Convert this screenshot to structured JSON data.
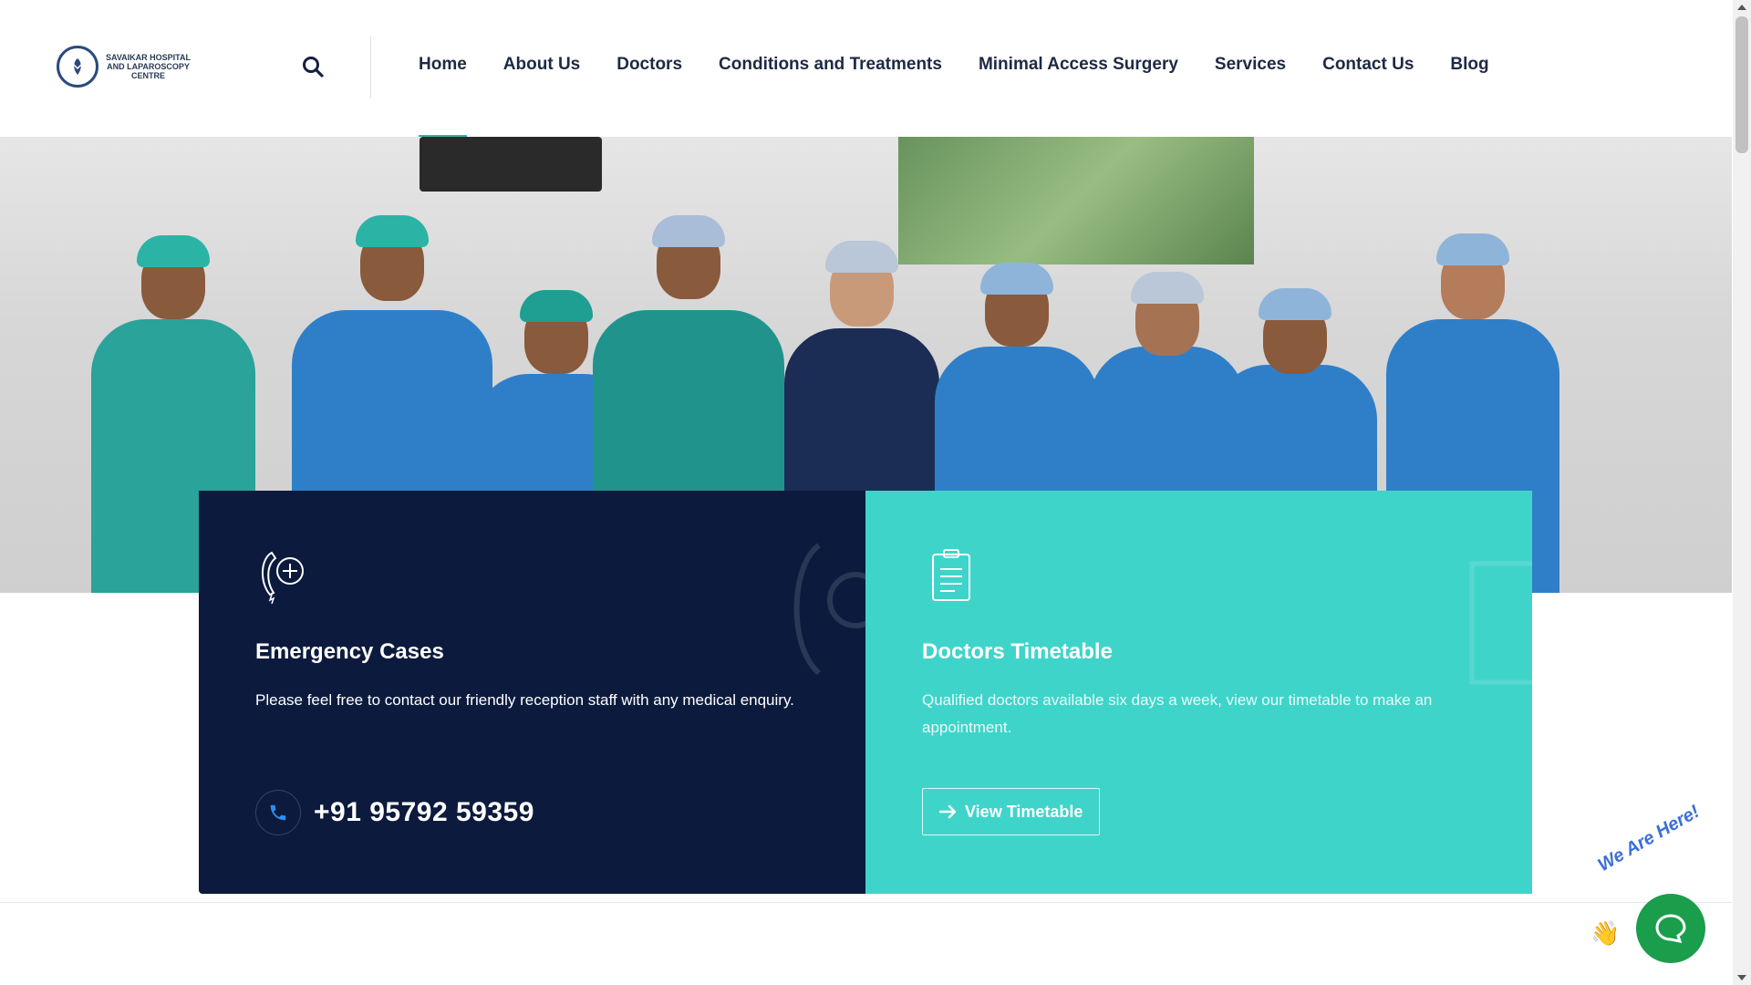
{
  "header": {
    "logo": {
      "name_line1": "SAVAIKAR HOSPITAL",
      "name_line2": "AND LAPAROSCOPY",
      "name_line3": "CENTRE"
    },
    "search_icon": "search-icon",
    "nav": [
      {
        "label": "Home",
        "active": true
      },
      {
        "label": "About Us"
      },
      {
        "label": "Doctors"
      },
      {
        "label": "Conditions and Treatments"
      },
      {
        "label": "Minimal Access Surgery"
      },
      {
        "label": "Services"
      },
      {
        "label": "Contact Us"
      },
      {
        "label": "Blog"
      }
    ]
  },
  "cards": {
    "emergency": {
      "icon": "phone-plus-icon",
      "title": "Emergency Cases",
      "text": "Please feel free to contact our friendly reception staff with any medical enquiry.",
      "phone_icon": "phone-icon",
      "phone": "+91 95792 59359"
    },
    "timetable": {
      "icon": "clipboard-icon",
      "title": "Doctors Timetable",
      "text": "Qualified doctors available six days a week, view our timetable to make an appointment.",
      "button_icon": "arrow-right-icon",
      "button_label": "View Timetable"
    }
  },
  "chat": {
    "label": "We Are Here!",
    "icon": "chat-icon",
    "wave_icon": "waving-hand-icon"
  },
  "colors": {
    "navy": "#0c1b3d",
    "teal": "#3fd4ca",
    "nav_text": "#1d2a44",
    "active_underline": "#2bb3b0",
    "chat_green": "#1a9e4b"
  }
}
